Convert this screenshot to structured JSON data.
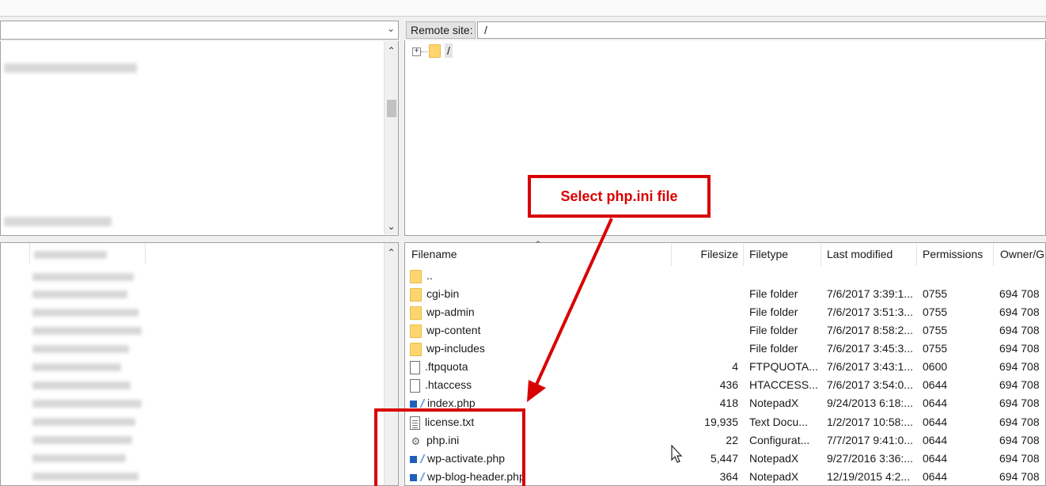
{
  "remote_site": {
    "label": "Remote site:",
    "path": "/"
  },
  "tree": {
    "root_label": "/"
  },
  "annotation": {
    "callout": "Select php.ini file"
  },
  "columns": {
    "filename": "Filename",
    "filesize": "Filesize",
    "filetype": "Filetype",
    "last_modified": "Last modified",
    "permissions": "Permissions",
    "owner": "Owner/G"
  },
  "files": [
    {
      "icon": "folder-icon",
      "name": "..",
      "size": "",
      "type": "",
      "modified": "",
      "perm": "",
      "owner": ""
    },
    {
      "icon": "folder-icon",
      "name": "cgi-bin",
      "size": "",
      "type": "File folder",
      "modified": "7/6/2017 3:39:1...",
      "perm": "0755",
      "owner": "694 708"
    },
    {
      "icon": "folder-icon",
      "name": "wp-admin",
      "size": "",
      "type": "File folder",
      "modified": "7/6/2017 3:51:3...",
      "perm": "0755",
      "owner": "694 708"
    },
    {
      "icon": "folder-icon",
      "name": "wp-content",
      "size": "",
      "type": "File folder",
      "modified": "7/6/2017 8:58:2...",
      "perm": "0755",
      "owner": "694 708"
    },
    {
      "icon": "folder-icon",
      "name": "wp-includes",
      "size": "",
      "type": "File folder",
      "modified": "7/6/2017 3:45:3...",
      "perm": "0755",
      "owner": "694 708"
    },
    {
      "icon": "file-icon",
      "name": ".ftpquota",
      "size": "4",
      "type": "FTPQUOTA...",
      "modified": "7/6/2017 3:43:1...",
      "perm": "0600",
      "owner": "694 708"
    },
    {
      "icon": "file-icon",
      "name": ".htaccess",
      "size": "436",
      "type": "HTACCESS...",
      "modified": "7/6/2017 3:54:0...",
      "perm": "0644",
      "owner": "694 708"
    },
    {
      "icon": "notepadx-icon",
      "name": "index.php",
      "size": "418",
      "type": "NotepadX",
      "modified": "9/24/2013 6:18:...",
      "perm": "0644",
      "owner": "694 708"
    },
    {
      "icon": "text-file-icon",
      "name": "license.txt",
      "size": "19,935",
      "type": "Text Docu...",
      "modified": "1/2/2017 10:58:...",
      "perm": "0644",
      "owner": "694 708"
    },
    {
      "icon": "config-file-icon",
      "name": "php.ini",
      "size": "22",
      "type": "Configurat...",
      "modified": "7/7/2017 9:41:0...",
      "perm": "0644",
      "owner": "694 708"
    },
    {
      "icon": "notepadx-icon",
      "name": "wp-activate.php",
      "size": "5,447",
      "type": "NotepadX",
      "modified": "9/27/2016 3:36:...",
      "perm": "0644",
      "owner": "694 708"
    },
    {
      "icon": "notepadx-icon",
      "name": "wp-blog-header.php",
      "size": "364",
      "type": "NotepadX",
      "modified": "12/19/2015 4:2...",
      "perm": "0644",
      "owner": "694 708"
    }
  ]
}
